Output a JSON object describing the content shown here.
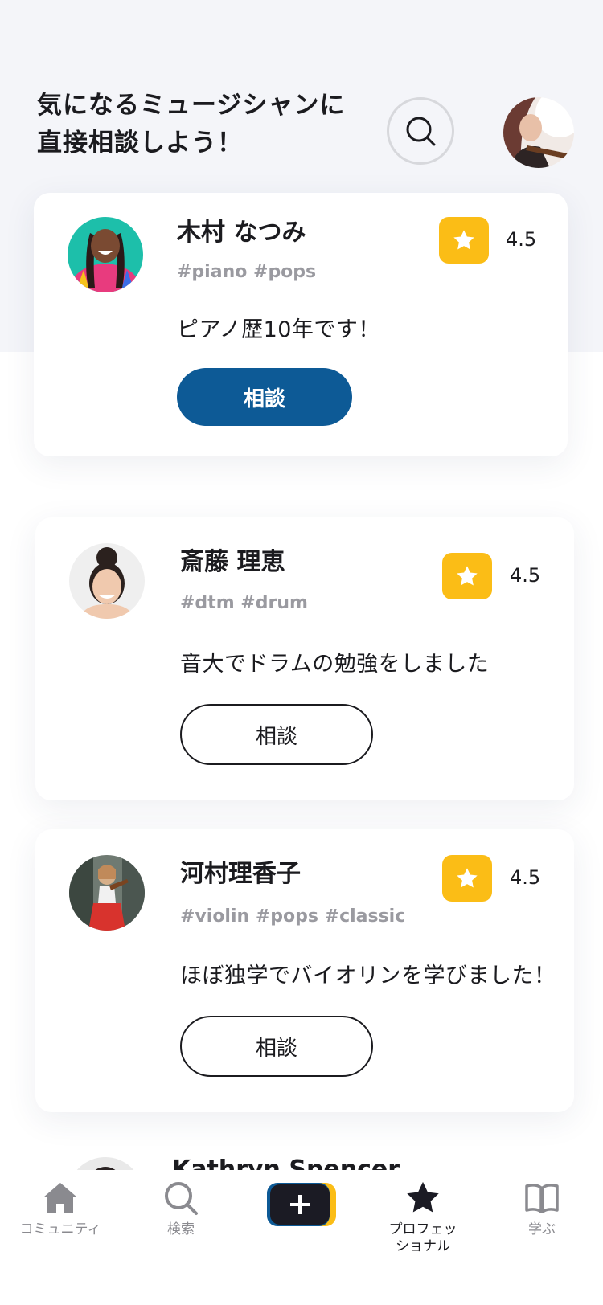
{
  "header": {
    "title": "気になるミュージシャンに\n直接相談しよう！"
  },
  "musicians": [
    {
      "name": "木村 なつみ",
      "tags": "#piano #pops",
      "bio": "ピアノ歴10年です！",
      "rating": "4.5",
      "button_label": "相談"
    },
    {
      "name": "斎藤 理恵",
      "tags": "#dtm #drum",
      "bio": "音大でドラムの勉強をしました",
      "rating": "4.5",
      "button_label": "相談"
    },
    {
      "name": "河村理香子",
      "tags": "#violin #pops #classic",
      "bio": "ほぼ独学でバイオリンを学びました！",
      "rating": "4.5",
      "button_label": "相談"
    },
    {
      "name": "Kathryn Spencer"
    }
  ],
  "tabbar": {
    "items": [
      {
        "label": "コミュニティ",
        "icon": "home-icon"
      },
      {
        "label": "検索",
        "icon": "search-icon"
      },
      {
        "label": "",
        "icon": "plus-icon"
      },
      {
        "label": "プロフェッ\nショナル",
        "icon": "star-icon",
        "active": true
      },
      {
        "label": "学ぶ",
        "icon": "book-icon"
      }
    ]
  },
  "colors": {
    "accent_blue": "#0d5a96",
    "star_yellow": "#fbbd16",
    "header_bg": "#f4f5f9"
  }
}
